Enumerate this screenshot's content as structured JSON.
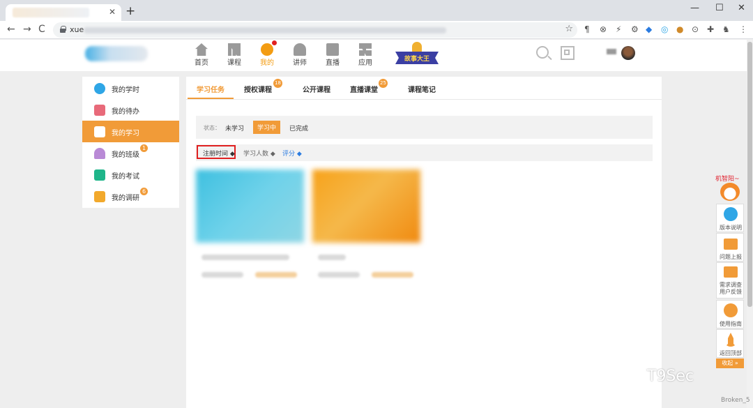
{
  "browser": {
    "tab_close": "✕",
    "new_tab": "+",
    "win_min": "—",
    "win_max": "☐",
    "win_close": "✕",
    "back": "←",
    "forward": "→",
    "reload": "C",
    "url_prefix": "xue",
    "star": "☆"
  },
  "nav": {
    "items": [
      {
        "label": "首页",
        "icon": "home-icon"
      },
      {
        "label": "课程",
        "icon": "books-icon"
      },
      {
        "label": "我的",
        "icon": "my-icon"
      },
      {
        "label": "讲师",
        "icon": "lecturer-icon"
      },
      {
        "label": "直播",
        "icon": "live-icon"
      },
      {
        "label": "应用",
        "icon": "apps-icon"
      }
    ],
    "banner": "故事大王"
  },
  "sidebar": {
    "items": [
      {
        "label": "我的学时",
        "color": "#2fa6e6"
      },
      {
        "label": "我的待办",
        "color": "#e86a7a"
      },
      {
        "label": "我的学习",
        "color": "#f19b38"
      },
      {
        "label": "我的班级",
        "color": "#b98ad6",
        "badge": "1"
      },
      {
        "label": "我的考试",
        "color": "#1fb58a"
      },
      {
        "label": "我的调研",
        "color": "#f2a92c",
        "badge": "6"
      }
    ]
  },
  "tabs": [
    {
      "label": "学习任务"
    },
    {
      "label": "授权课程",
      "badge": "18"
    },
    {
      "label": "公开课程"
    },
    {
      "label": "直播课堂",
      "badge": "25"
    },
    {
      "label": "课程笔记"
    }
  ],
  "filter": {
    "label": "状态：",
    "options": [
      "未学习",
      "学习中",
      "已完成"
    ]
  },
  "sort": {
    "options": [
      "注册时间 ◆",
      "学习人数 ◆",
      "评分 ◆"
    ]
  },
  "float_bar": {
    "head": "机智阳~",
    "items": [
      "版本说明",
      "问题上报",
      "需求调查\n用户反馈",
      "使用指南",
      "返回顶部"
    ],
    "collapse": "收起 »"
  },
  "watermark": "T9Sec",
  "corner": "Broken_5"
}
